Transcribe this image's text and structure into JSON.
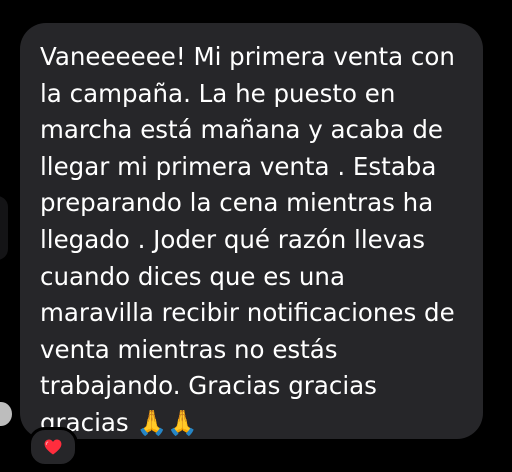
{
  "message": {
    "text": "Vaneeeeee! Mi primera venta con\nla campaña. La he puesto en\nmarcha está mañana y acaba de\nllegar mi primera venta . Estaba\npreparando la cena mientras ha\nllegado . Joder qué razón llevas\ncuando dices que es una\nmaravilla recibir notificaciones de\nventa mientras no estás\ntrabajando. Gracias gracias\ngracias 🙏🙏"
  },
  "reaction": {
    "emoji": "❤️",
    "icon": "red-heart-icon",
    "color": "#ff2d3d"
  },
  "colors": {
    "background": "#000000",
    "bubble": "#262629",
    "text": "#ffffff"
  }
}
